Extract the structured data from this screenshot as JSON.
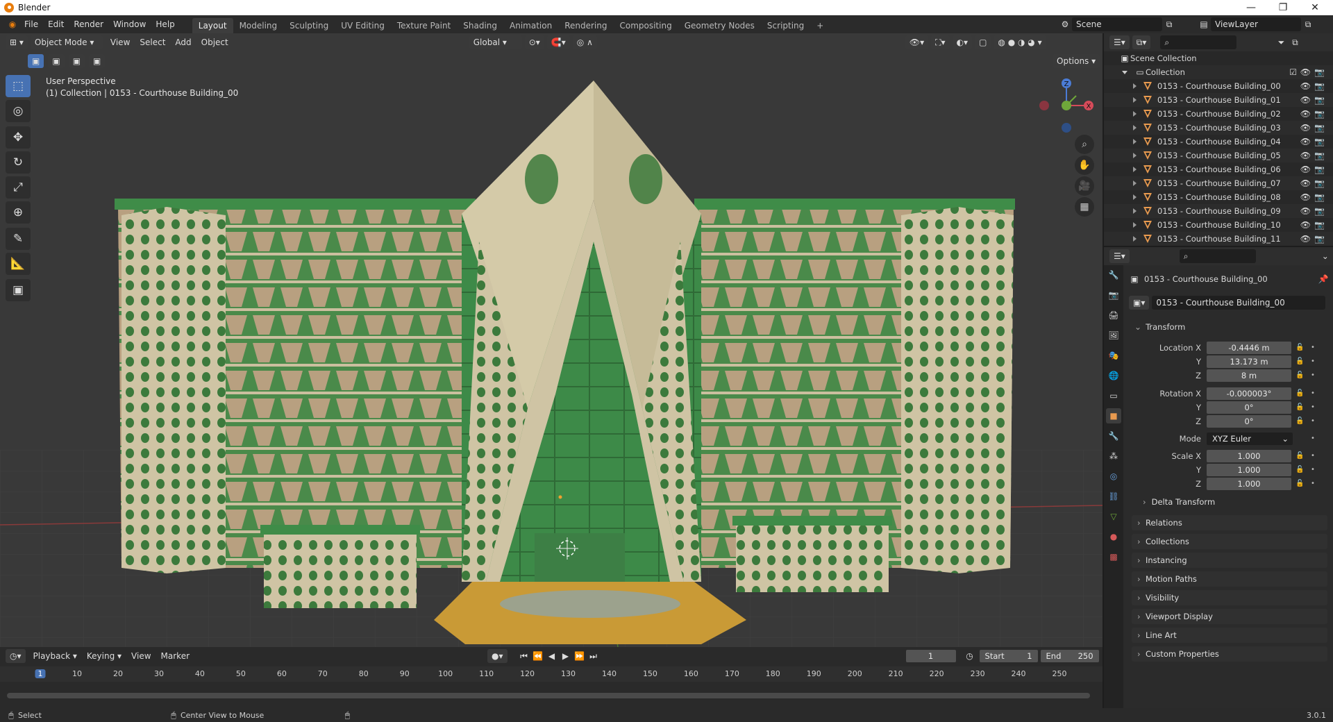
{
  "window": {
    "title": "Blender",
    "minimize": "—",
    "maximize": "❐",
    "close": "✕"
  },
  "menu": [
    "File",
    "Edit",
    "Render",
    "Window",
    "Help"
  ],
  "workspaces": [
    "Layout",
    "Modeling",
    "Sculpting",
    "UV Editing",
    "Texture Paint",
    "Shading",
    "Animation",
    "Rendering",
    "Compositing",
    "Geometry Nodes",
    "Scripting",
    "+"
  ],
  "scene": {
    "label": "Scene",
    "viewlayer": "ViewLayer"
  },
  "viewport": {
    "mode": "Object Mode",
    "menus": [
      "View",
      "Select",
      "Add",
      "Object"
    ],
    "orientation": "Global",
    "options": "Options",
    "perspective": "User Perspective",
    "collection_info": "(1) Collection | 0153 - Courthouse Building_00",
    "gizmo": {
      "x": "X",
      "y": "Y",
      "z": "Z"
    }
  },
  "tools": [
    {
      "name": "select-box-tool",
      "glyph": "⬚"
    },
    {
      "name": "cursor-tool",
      "glyph": "◎"
    },
    {
      "name": "move-tool",
      "glyph": "✥"
    },
    {
      "name": "rotate-tool",
      "glyph": "↻"
    },
    {
      "name": "scale-tool",
      "glyph": "⤢"
    },
    {
      "name": "transform-tool",
      "glyph": "⊕"
    },
    {
      "name": "annotate-tool",
      "glyph": "✎"
    },
    {
      "name": "measure-tool",
      "glyph": "📐"
    },
    {
      "name": "add-cube-tool",
      "glyph": "▣"
    }
  ],
  "outliner": {
    "scene_collection": "Scene Collection",
    "collection": "Collection",
    "items": [
      "0153 - Courthouse Building_00",
      "0153 - Courthouse Building_01",
      "0153 - Courthouse Building_02",
      "0153 - Courthouse Building_03",
      "0153 - Courthouse Building_04",
      "0153 - Courthouse Building_05",
      "0153 - Courthouse Building_06",
      "0153 - Courthouse Building_07",
      "0153 - Courthouse Building_08",
      "0153 - Courthouse Building_09",
      "0153 - Courthouse Building_10",
      "0153 - Courthouse Building_11"
    ]
  },
  "properties": {
    "object_name": "0153 - Courthouse Building_00",
    "data_name": "0153 - Courthouse Building_00",
    "transform_title": "Transform",
    "location_label": "Location X",
    "y_label": "Y",
    "z_label": "Z",
    "location": [
      "-0.4446 m",
      "13.173 m",
      "8 m"
    ],
    "rotation_label": "Rotation X",
    "rotation": [
      "-0.000003°",
      "0°",
      "0°"
    ],
    "mode_label": "Mode",
    "mode": "XYZ Euler",
    "scale_label": "Scale X",
    "scale": [
      "1.000",
      "1.000",
      "1.000"
    ],
    "delta": "Delta Transform",
    "sections": [
      "Relations",
      "Collections",
      "Instancing",
      "Motion Paths",
      "Visibility",
      "Viewport Display",
      "Line Art",
      "Custom Properties"
    ]
  },
  "timeline": {
    "menus": [
      "Playback",
      "Keying",
      "View",
      "Marker"
    ],
    "current_frame": "1",
    "start_label": "Start",
    "start": "1",
    "end_label": "End",
    "end": "250",
    "ticks": [
      "1",
      "10",
      "20",
      "30",
      "40",
      "50",
      "60",
      "70",
      "80",
      "90",
      "100",
      "110",
      "120",
      "130",
      "140",
      "150",
      "160",
      "170",
      "180",
      "190",
      "200",
      "210",
      "220",
      "230",
      "240",
      "250"
    ]
  },
  "status": {
    "select": "Select",
    "center": "Center View to Mouse",
    "version": "3.0.1"
  }
}
